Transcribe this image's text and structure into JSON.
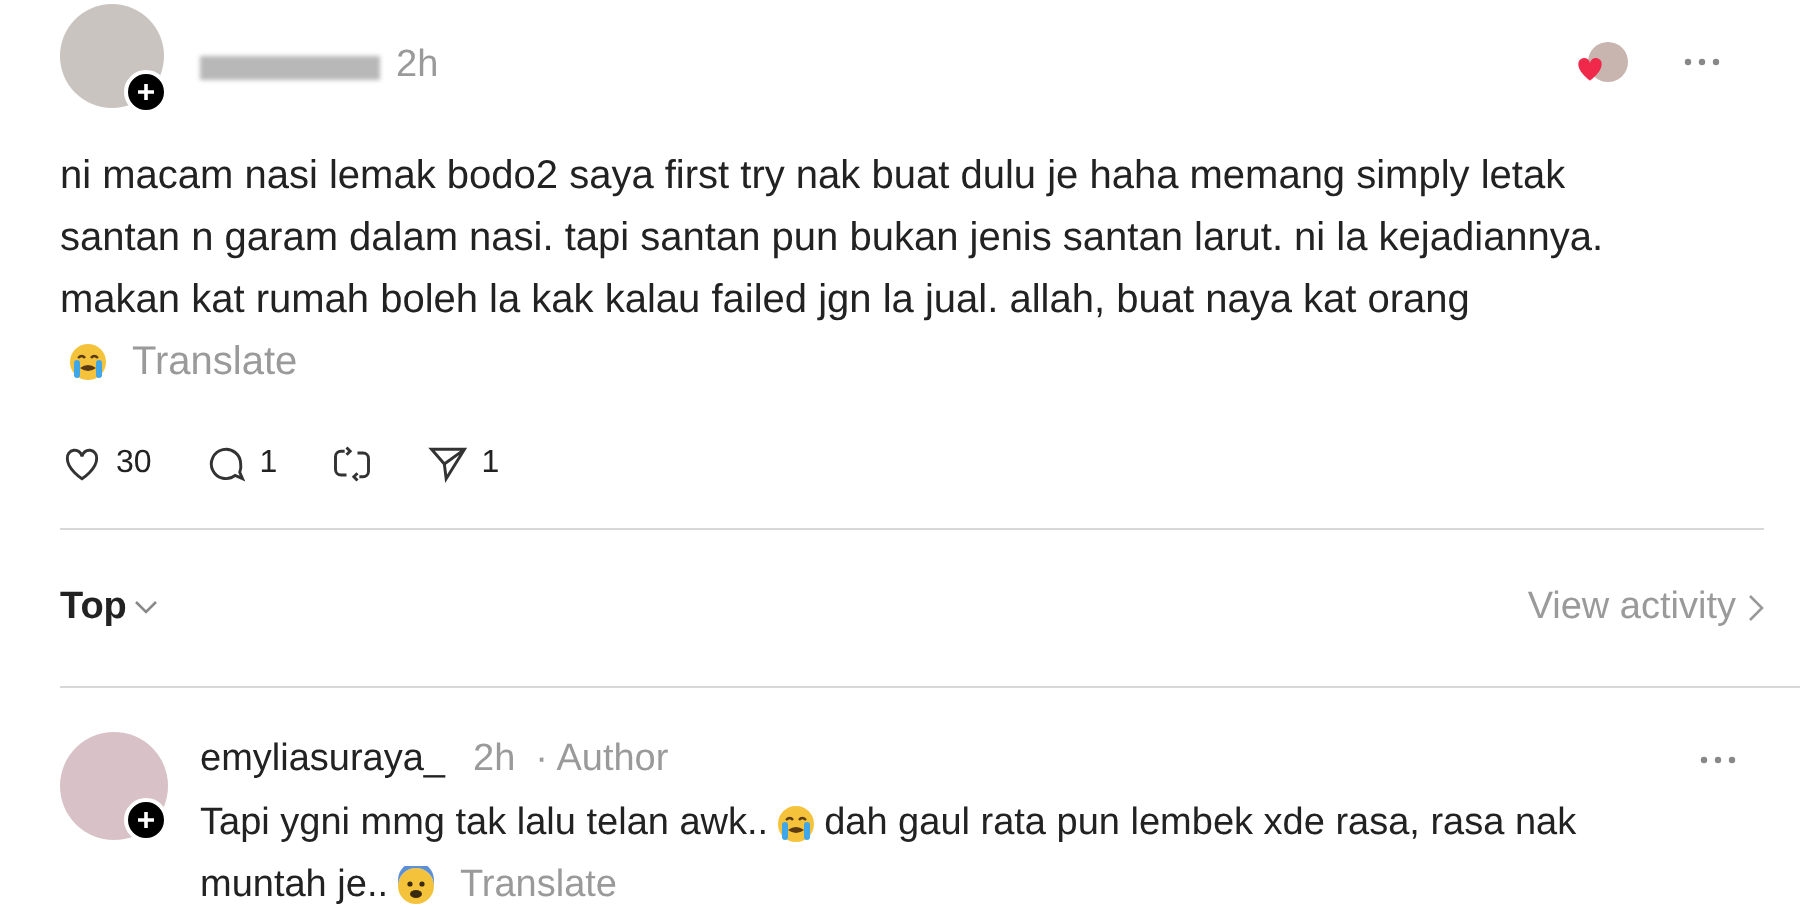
{
  "post": {
    "time": "2h",
    "lines": [
      [
        {
          "kind": "text",
          "text": "ni macam nasi lemak bodo2 saya first try nak buat dulu je haha memang simply letak"
        }
      ],
      [
        {
          "kind": "text",
          "text": "santan n garam dalam nasi. tapi santan pun bukan jenis santan larut. ni la kejadiannya."
        }
      ],
      [
        {
          "kind": "text",
          "text": "makan kat rumah boleh la kak kalau failed jgn la jual. allah, buat naya kat orang"
        }
      ],
      [
        {
          "kind": "crying_emoji"
        },
        {
          "kind": "link",
          "text": "Translate"
        }
      ]
    ],
    "actions": [
      {
        "kind": "like",
        "count": "30"
      },
      {
        "kind": "reply",
        "count": "1"
      },
      {
        "kind": "repost"
      },
      {
        "kind": "share",
        "count": "1"
      }
    ]
  },
  "sort": {
    "label": "Top",
    "activity": "View activity"
  },
  "comment": {
    "username": "emyliasuraya_",
    "time": "2h",
    "badge": "· Author",
    "lines": [
      [
        {
          "kind": "text",
          "text": "Tapi ygni mmg tak lalu telan awk.."
        },
        {
          "kind": "crying_emoji"
        },
        {
          "kind": "text",
          "text": "dah gaul rata pun lembek xde rasa, rasa nak"
        }
      ],
      [
        {
          "kind": "text",
          "text": "muntah je.."
        },
        {
          "kind": "anxious_emoji"
        },
        {
          "kind": "link",
          "text": "Translate"
        }
      ]
    ]
  }
}
